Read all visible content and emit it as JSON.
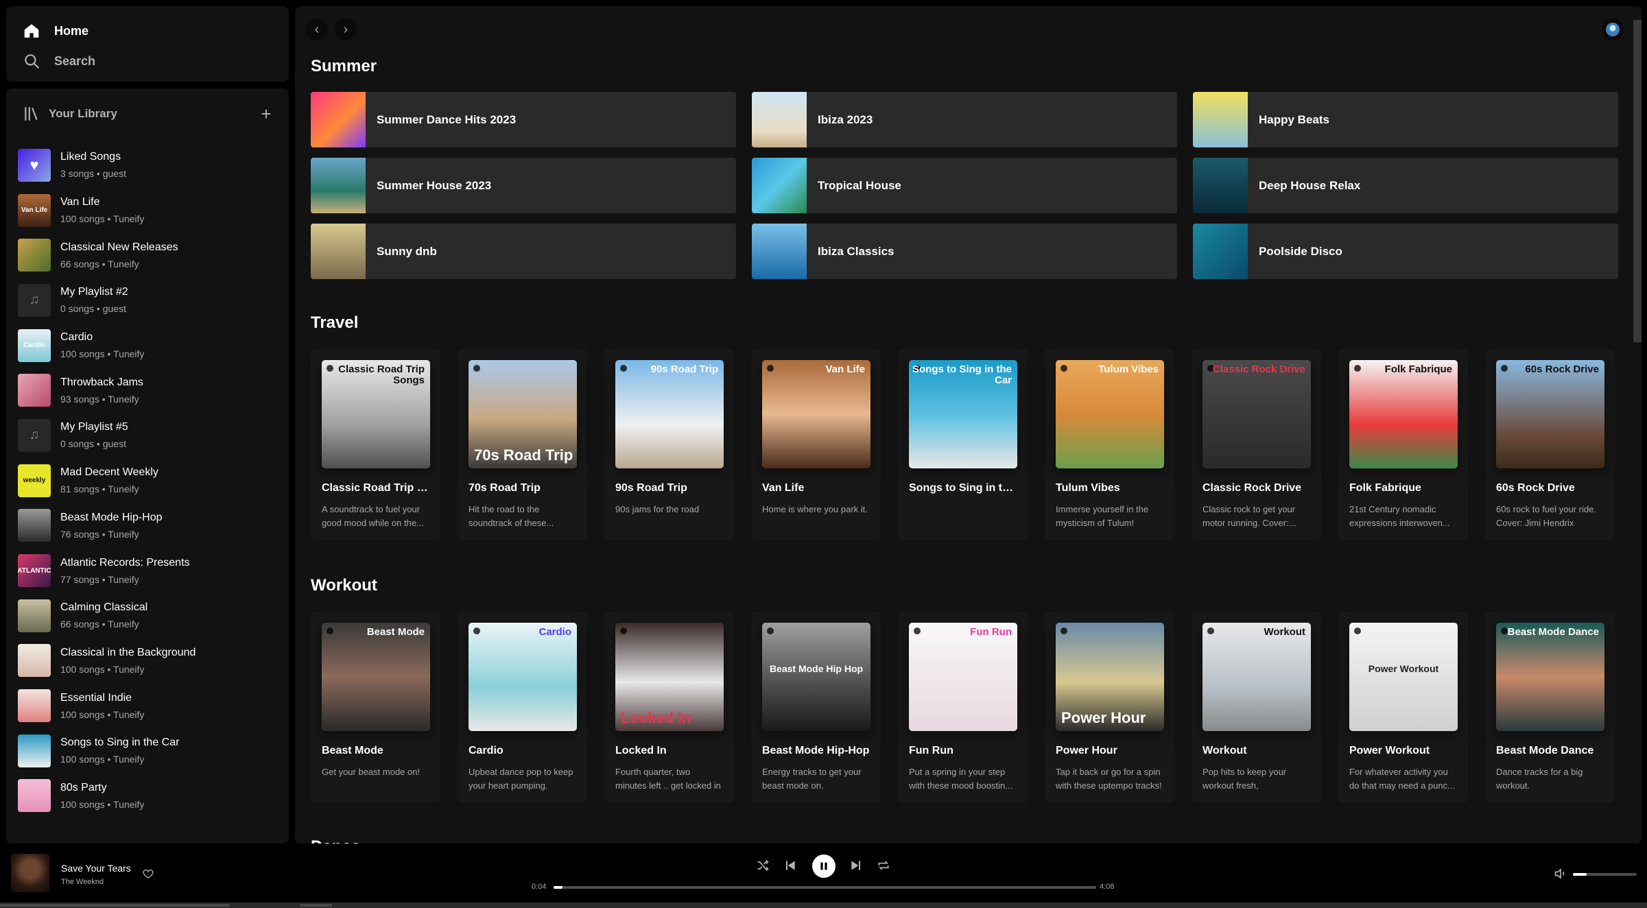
{
  "nav": {
    "home_label": "Home",
    "search_label": "Search"
  },
  "library": {
    "title": "Your Library",
    "add_label": "+",
    "items": [
      {
        "name": "Liked Songs",
        "sub": "3 songs • guest",
        "thumb_bg": "linear-gradient(135deg,#4a1ee6,#8aa6e0)",
        "thumb_text": "♥"
      },
      {
        "name": "Van Life",
        "sub": "100 songs • Tuneify",
        "thumb_bg": "linear-gradient(180deg,#b06a3a,#3c2014)",
        "thumb_text": "Van Life"
      },
      {
        "name": "Classical New Releases",
        "sub": "66 songs • Tuneify",
        "thumb_bg": "linear-gradient(135deg,#c8a34a,#4d6a2a)",
        "thumb_text": ""
      },
      {
        "name": "My Playlist #2",
        "sub": "0 songs • guest",
        "thumb_bg": "#282828",
        "thumb_text": "♫"
      },
      {
        "name": "Cardio",
        "sub": "100 songs • Tuneify",
        "thumb_bg": "linear-gradient(180deg,#e8f0f4,#7ec9d6)",
        "thumb_text": "Cardio"
      },
      {
        "name": "Throwback Jams",
        "sub": "93 songs • Tuneify",
        "thumb_bg": "linear-gradient(135deg,#e8a6b8,#b84a6a)",
        "thumb_text": ""
      },
      {
        "name": "My Playlist #5",
        "sub": "0 songs • guest",
        "thumb_bg": "#282828",
        "thumb_text": "♫"
      },
      {
        "name": "Mad Decent Weekly",
        "sub": "81 songs • Tuneify",
        "thumb_bg": "#e6e62a",
        "thumb_text": "weekly"
      },
      {
        "name": "Beast Mode Hip-Hop",
        "sub": "76 songs • Tuneify",
        "thumb_bg": "linear-gradient(180deg,#9a9a9a,#2a2a2a)",
        "thumb_text": ""
      },
      {
        "name": "Atlantic Records: Presents",
        "sub": "77 songs • Tuneify",
        "thumb_bg": "linear-gradient(135deg,#d83a6a,#3a1a4a)",
        "thumb_text": "ATLANTIC"
      },
      {
        "name": "Calming Classical",
        "sub": "66 songs • Tuneify",
        "thumb_bg": "linear-gradient(180deg,#c8c0a0,#6a6a50)",
        "thumb_text": ""
      },
      {
        "name": "Classical in the Background",
        "sub": "100 songs • Tuneify",
        "thumb_bg": "linear-gradient(180deg,#f0ece4,#d8b8a8)",
        "thumb_text": ""
      },
      {
        "name": "Essential Indie",
        "sub": "100 songs • Tuneify",
        "thumb_bg": "linear-gradient(180deg,#f4e4e0,#e08080)",
        "thumb_text": ""
      },
      {
        "name": "Songs to Sing in the Car",
        "sub": "100 songs • Tuneify",
        "thumb_bg": "linear-gradient(180deg,#2a9ac0,#f0f0f0)",
        "thumb_text": ""
      },
      {
        "name": "80s Party",
        "sub": "100 songs • Tuneify",
        "thumb_bg": "linear-gradient(180deg,#f4c0d8,#e890b8)",
        "thumb_text": ""
      }
    ]
  },
  "topbar": {
    "back_icon": "chevron-left-icon",
    "forward_icon": "chevron-right-icon",
    "back_glyph": "‹",
    "forward_glyph": "›"
  },
  "summer": {
    "title": "Summer",
    "shortcuts": [
      {
        "label": "Summer Dance Hits 2023",
        "bg": "linear-gradient(135deg,#ff3a7a,#ff8a3a 55%,#7a3aff)"
      },
      {
        "label": "Ibiza 2023",
        "bg": "linear-gradient(180deg,#cfe6f4,#e8dcc4 70%,#c8b08a)"
      },
      {
        "label": "Happy Beats",
        "bg": "linear-gradient(180deg,#f0e060,#8ac0d8)"
      },
      {
        "label": "Summer House 2023",
        "bg": "linear-gradient(180deg,#6aa6c8,#2a7a6a 60%,#c8b07a)"
      },
      {
        "label": "Tropical House",
        "bg": "linear-gradient(135deg,#2a9ad8,#5ac8e8 50%,#2a8a4a)"
      },
      {
        "label": "Deep House Relax",
        "bg": "linear-gradient(180deg,#1a5a6a,#0a2a3a)"
      },
      {
        "label": "Sunny dnb",
        "bg": "linear-gradient(180deg,#d8c890,#7a6a4a)"
      },
      {
        "label": "Ibiza Classics",
        "bg": "linear-gradient(180deg,#7ac0e8,#1a6aa8)"
      },
      {
        "label": "Poolside Disco",
        "bg": "linear-gradient(135deg,#1a8aa0,#0a4a6a)"
      }
    ]
  },
  "travel": {
    "title": "Travel",
    "cards": [
      {
        "title": "Classic Road Trip S...",
        "desc": "A soundtrack to fuel your good mood while on the...",
        "cover_text": "Classic Road Trip Songs",
        "cover_text_pos": "top",
        "bg": "linear-gradient(180deg,#e8e8e8,#a0a0a0 60%,#505050)",
        "text_color": "#111"
      },
      {
        "title": "70s Road Trip",
        "desc": "Hit the road to the soundtrack of these...",
        "cover_text": "70s Road Trip",
        "cover_text_pos": "bottom",
        "bg": "linear-gradient(180deg,#aac8e8,#c8a880 55%,#3a3a3a)",
        "text_color": "#fff"
      },
      {
        "title": "90s Road Trip",
        "desc": "90s jams for the road",
        "cover_text": "90s Road Trip",
        "cover_text_pos": "top",
        "bg": "linear-gradient(180deg,#7ab8e8,#f0f0f0 60%,#b8a890)",
        "text_color": "#fff"
      },
      {
        "title": "Van Life",
        "desc": "Home is where you park it.",
        "cover_text": "Van Life",
        "cover_text_pos": "top",
        "bg": "linear-gradient(180deg,#a86a3a,#e8b890 50%,#4a2a1a)",
        "text_color": "#fff"
      },
      {
        "title": "Songs to Sing in the...",
        "desc": "",
        "cover_text": "Songs to Sing in the Car",
        "cover_text_pos": "top",
        "bg": "linear-gradient(180deg,#1a9ac8,#5ac0e0 50%,#e8e8e8)",
        "text_color": "#fff"
      },
      {
        "title": "Tulum Vibes",
        "desc": "Immerse yourself in the mysticism of Tulum!",
        "cover_text": "Tulum Vibes",
        "cover_text_pos": "top",
        "bg": "linear-gradient(180deg,#e8a85a,#d88a3a 50%,#6aa04a)",
        "text_color": "#fff"
      },
      {
        "title": "Classic Rock Drive",
        "desc": "Classic rock to get your motor running. Cover:...",
        "cover_text": "Classic Rock Drive",
        "cover_text_pos": "top",
        "bg": "linear-gradient(180deg,#4a4a4a,#2a2a2a)",
        "text_color": "#e8344a"
      },
      {
        "title": "Folk Fabrique",
        "desc": "21st Century nomadic expressions interwoven...",
        "cover_text": "Folk Fabrique",
        "cover_text_pos": "top",
        "bg": "linear-gradient(180deg,#f4f4f4,#e83a3a 60%,#3a8a4a)",
        "text_color": "#111"
      },
      {
        "title": "60s Rock Drive",
        "desc": "60s rock to fuel your ride. Cover: Jimi Hendrix",
        "cover_text": "60s Rock Drive",
        "cover_text_pos": "top",
        "bg": "linear-gradient(180deg,#8ab8e0,#6a4a3a 70%,#3a2a1a)",
        "text_color": "#111"
      }
    ]
  },
  "workout": {
    "title": "Workout",
    "cards": [
      {
        "title": "Beast Mode",
        "desc": "Get your beast mode on!",
        "cover_text": "Beast Mode",
        "cover_text_pos": "top",
        "bg": "linear-gradient(180deg,#3a3a3a,#8a6a5a 50%,#2a2a2a)",
        "text_color": "#fff"
      },
      {
        "title": "Cardio",
        "desc": "Upbeat dance pop to keep your heart pumping.",
        "cover_text": "Cardio",
        "cover_text_pos": "top",
        "bg": "linear-gradient(180deg,#e8f4f8,#8ad0d8 60%,#e8e8e8)",
        "text_color": "#5a3aff"
      },
      {
        "title": "Locked In",
        "desc": "Fourth quarter, two minutes left .. get locked in",
        "cover_text": "Locked In",
        "cover_text_pos": "bottom",
        "bg": "linear-gradient(180deg,#3a2a2a,#e8e8e8 55%,#4a3a3a)",
        "text_color": "#e8344a"
      },
      {
        "title": "Beast Mode Hip-Hop",
        "desc": "Energy tracks to get your beast mode on.",
        "cover_text": "Beast Mode Hip Hop",
        "cover_text_pos": "center",
        "bg": "linear-gradient(180deg,#a0a0a0,#4a4a4a 60%,#1a1a1a)",
        "text_color": "#fff"
      },
      {
        "title": "Fun Run",
        "desc": "Put a spring in your step with these mood boostin...",
        "cover_text": "Fun Run",
        "cover_text_pos": "top",
        "bg": "linear-gradient(180deg,#f8f8f8,#e8d8e0)",
        "text_color": "#e83aa0"
      },
      {
        "title": "Power Hour",
        "desc": "Tap it back or go for a spin with these uptempo tracks!",
        "cover_text": "Power Hour",
        "cover_text_pos": "bottom",
        "bg": "linear-gradient(180deg,#6a8aa8,#d8c890 55%,#2a2a2a)",
        "text_color": "#fff"
      },
      {
        "title": "Workout",
        "desc": "Pop hits to keep your workout fresh,",
        "cover_text": "Workout",
        "cover_text_pos": "top",
        "bg": "linear-gradient(180deg,#e8e8e8,#b8c0c8 60%,#8a8a8a)",
        "text_color": "#111"
      },
      {
        "title": "Power Workout",
        "desc": "For whatever activity you do that may need a punc...",
        "cover_text": "Power Workout",
        "cover_text_pos": "center",
        "bg": "linear-gradient(180deg,#f4f4f4,#d0d0d0)",
        "text_color": "#222"
      },
      {
        "title": "Beast Mode Dance",
        "desc": "Dance tracks for a big workout.",
        "cover_text": "Beast Mode Dance",
        "cover_text_pos": "top",
        "bg": "linear-gradient(180deg,#1a5a5a,#c88a6a 50%,#2a3a3a)",
        "text_color": "#fff"
      }
    ]
  },
  "next_section_peek": "Dance",
  "player": {
    "track_title": "Save Your Tears",
    "artist": "The Weeknd",
    "elapsed": "0:04",
    "duration": "4:08",
    "progress_fraction": 0.016,
    "volume_fraction": 0.22
  },
  "colors": {
    "background": "#000000",
    "panel": "#121212",
    "card": "#181818",
    "shortcut": "#2a2a2a",
    "text_secondary": "#a7a7a7"
  }
}
